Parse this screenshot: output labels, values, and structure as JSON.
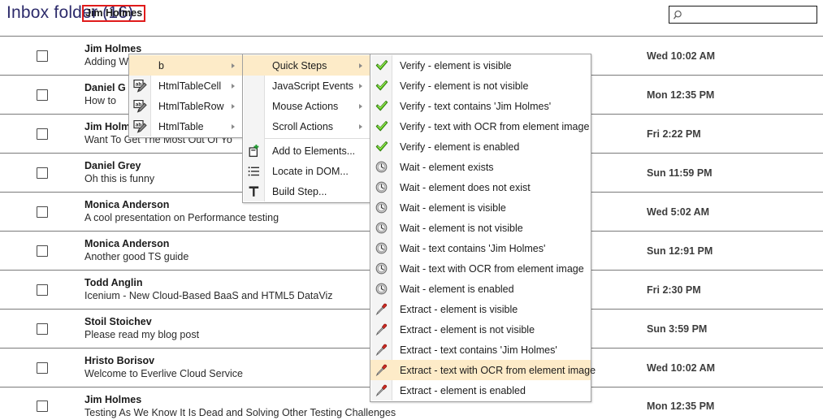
{
  "header": {
    "title": "Inbox folder (16)",
    "search": {
      "placeholder": "",
      "value": "",
      "icon": "search-icon"
    }
  },
  "mail_list": {
    "rows": [
      {
        "sender": "Jim Holmes",
        "subject": "Adding W",
        "date": "Wed 10:02 AM",
        "selected": true
      },
      {
        "sender": "Daniel G",
        "subject": "How to",
        "date": "Mon 12:35 PM",
        "selected": false
      },
      {
        "sender": "Jim Holm",
        "subject": "Want To Get The Most Out Of Yo",
        "date": "Fri 2:22 PM",
        "selected": false
      },
      {
        "sender": "Daniel Grey",
        "subject": "Oh this is funny",
        "date": "Sun 11:59 PM",
        "selected": false
      },
      {
        "sender": "Monica Anderson",
        "subject": "A cool presentation on Performance testing",
        "date": "Wed 5:02 AM",
        "selected": false
      },
      {
        "sender": "Monica Anderson",
        "subject": "Another good TS guide",
        "date": "Sun 12:91 PM",
        "selected": false
      },
      {
        "sender": "Todd Anglin",
        "subject": "Icenium - New Cloud-Based BaaS and HTML5 DataViz",
        "date": "Fri 2:30 PM",
        "selected": false
      },
      {
        "sender": "Stoil Stoichev",
        "subject": "Please read my blog post",
        "date": "Sun 3:59 PM",
        "selected": false
      },
      {
        "sender": "Hristo Borisov",
        "subject": "Welcome to Everlive Cloud Service",
        "date": "Wed 10:02 AM",
        "selected": false
      },
      {
        "sender": "Jim Holmes",
        "subject": "Testing As We Know It Is Dead and Solving Other Testing Challenges",
        "date": "Mon 12:35 PM",
        "selected": false
      }
    ]
  },
  "menus": {
    "elements": {
      "items": [
        {
          "label": "b",
          "icon": "none",
          "submenu": true,
          "highlight": true
        },
        {
          "label": "HtmlTableCell",
          "icon": "ab-pencil-icon",
          "submenu": true,
          "highlight": false
        },
        {
          "label": "HtmlTableRow",
          "icon": "ab-pencil-icon",
          "submenu": true,
          "highlight": false
        },
        {
          "label": "HtmlTable",
          "icon": "ab-pencil-icon",
          "submenu": true,
          "highlight": false
        }
      ]
    },
    "actions": {
      "items": [
        {
          "label": "Quick Steps",
          "icon": "none",
          "submenu": true,
          "highlight": true,
          "separator_after": false
        },
        {
          "label": "JavaScript Events",
          "icon": "none",
          "submenu": true,
          "highlight": false,
          "separator_after": false
        },
        {
          "label": "Mouse Actions",
          "icon": "none",
          "submenu": true,
          "highlight": false,
          "separator_after": false
        },
        {
          "label": "Scroll Actions",
          "icon": "none",
          "submenu": true,
          "highlight": false,
          "separator_after": true
        },
        {
          "label": "Add to Elements...",
          "icon": "add-element-icon",
          "submenu": false,
          "highlight": false,
          "separator_after": false
        },
        {
          "label": "Locate in DOM...",
          "icon": "locate-dom-icon",
          "submenu": false,
          "highlight": false,
          "separator_after": false
        },
        {
          "label": "Build Step...",
          "icon": "build-step-icon",
          "submenu": false,
          "highlight": false,
          "separator_after": false
        }
      ]
    },
    "quick_steps": {
      "items": [
        {
          "label": "Verify - element is visible",
          "icon": "verify-check-icon",
          "highlight": false
        },
        {
          "label": "Verify - element is not visible",
          "icon": "verify-check-icon",
          "highlight": false
        },
        {
          "label": "Verify - text contains 'Jim Holmes'",
          "icon": "verify-check-icon",
          "highlight": false
        },
        {
          "label": "Verify - text with OCR from element image",
          "icon": "verify-check-icon",
          "highlight": false
        },
        {
          "label": "Verify - element is enabled",
          "icon": "verify-check-icon",
          "highlight": false
        },
        {
          "label": "Wait - element exists",
          "icon": "wait-clock-icon",
          "highlight": false
        },
        {
          "label": "Wait - element does not exist",
          "icon": "wait-clock-icon",
          "highlight": false
        },
        {
          "label": "Wait - element is visible",
          "icon": "wait-clock-icon",
          "highlight": false
        },
        {
          "label": "Wait - element is not visible",
          "icon": "wait-clock-icon",
          "highlight": false
        },
        {
          "label": "Wait - text contains 'Jim Holmes'",
          "icon": "wait-clock-icon",
          "highlight": false
        },
        {
          "label": "Wait - text with OCR from element image",
          "icon": "wait-clock-icon",
          "highlight": false
        },
        {
          "label": "Wait - element is enabled",
          "icon": "wait-clock-icon",
          "highlight": false
        },
        {
          "label": "Extract - element is visible",
          "icon": "extract-pipette-icon",
          "highlight": false
        },
        {
          "label": "Extract - element is not visible",
          "icon": "extract-pipette-icon",
          "highlight": false
        },
        {
          "label": "Extract - text contains 'Jim Holmes'",
          "icon": "extract-pipette-icon",
          "highlight": false
        },
        {
          "label": "Extract - text with OCR from element image",
          "icon": "extract-pipette-icon",
          "highlight": true
        },
        {
          "label": "Extract - element is enabled",
          "icon": "extract-pipette-icon",
          "highlight": false
        }
      ]
    }
  },
  "colors": {
    "title": "#2d2b6b",
    "menu_highlight": "#fdebc8",
    "selection_outline": "#e01b1b",
    "verify_green": "#4caf17",
    "extract_red": "#c0201b"
  }
}
